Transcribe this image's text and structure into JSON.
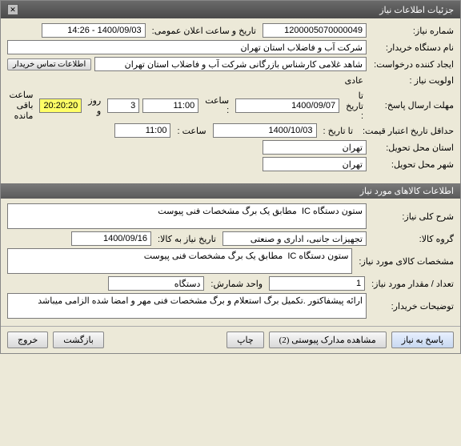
{
  "window": {
    "title": "جزئیات اطلاعات نیاز"
  },
  "need": {
    "number_label": "شماره نیاز:",
    "number": "1200005070000049",
    "announce_label": "تاریخ و ساعت اعلان عمومی:",
    "announce_value": "1400/09/03 - 14:26",
    "buyer_label": "نام دستگاه خریدار:",
    "buyer": "شرکت آب و فاضلاب استان تهران",
    "creator_label": "ایجاد کننده درخواست:",
    "creator": "شاهد غلامی کارشناس بازرگانی شرکت آب و فاضلاب استان تهران",
    "contact_btn": "اطلاعات تماس خریدار",
    "priority_label": "اولویت نیاز :",
    "priority": "عادی",
    "deadline_label": "مهلت ارسال پاسخ:",
    "to_date_label": "تا تاریخ :",
    "deadline_date": "1400/09/07",
    "time_label": "ساعت :",
    "deadline_time": "11:00",
    "days": "3",
    "days_and": "روز و",
    "remaining_time": "20:20:20",
    "remaining_label": "ساعت باقی مانده",
    "validity_label": "حداقل تاریخ اعتبار قیمت:",
    "validity_date": "1400/10/03",
    "validity_time": "11:00",
    "delivery_province_label": "استان محل تحویل:",
    "delivery_province": "تهران",
    "delivery_city_label": "شهر محل تحویل:",
    "delivery_city": "تهران"
  },
  "goods_header": "اطلاعات کالاهای مورد نیاز",
  "goods": {
    "desc_label": "شرح کلی نیاز:",
    "desc": "ستون دستگاه IC  مطابق یک برگ مشخصات فنی پیوست",
    "group_label": "گروه کالا:",
    "group": "تجهیزات جانبی، اداری و صنعتی",
    "need_date_label": "تاریخ نیاز به کالا:",
    "need_date": "1400/09/16",
    "spec_label": "مشخصات کالای مورد نیاز:",
    "spec": "ستون دستگاه IC  مطابق یک برگ مشخصات فنی پیوست",
    "qty_label": "تعداد / مقدار مورد نیاز:",
    "qty": "1",
    "unit_label": "واحد شمارش:",
    "unit": "دستگاه",
    "buyer_notes_label": "توضیحات خریدار:",
    "buyer_notes": "ارائه پیشفاکتور .تکمیل برگ استعلام و برگ مشخصات فنی مهر و امضا شده الزامی میباشد"
  },
  "buttons": {
    "reply": "پاسخ به نیاز",
    "attachments": "مشاهده مدارک پیوستی (2)",
    "print": "چاپ",
    "back": "بازگشت",
    "exit": "خروج"
  }
}
